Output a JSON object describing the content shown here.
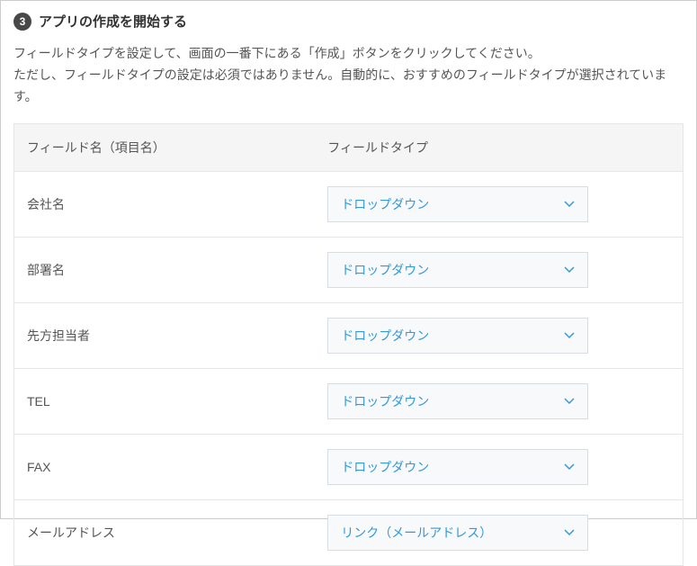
{
  "step": {
    "number": "3",
    "title": "アプリの作成を開始する"
  },
  "description": "フィールドタイプを設定して、画面の一番下にある「作成」ボタンをクリックしてください。\nただし、フィールドタイプの設定は必須ではありません。自動的に、おすすめのフィールドタイプが選択されています。",
  "table": {
    "headers": {
      "field_name": "フィールド名（項目名）",
      "field_type": "フィールドタイプ"
    },
    "rows": [
      {
        "name": "会社名",
        "type": "ドロップダウン"
      },
      {
        "name": "部署名",
        "type": "ドロップダウン"
      },
      {
        "name": "先方担当者",
        "type": "ドロップダウン"
      },
      {
        "name": "TEL",
        "type": "ドロップダウン"
      },
      {
        "name": "FAX",
        "type": "ドロップダウン"
      },
      {
        "name": "メールアドレス",
        "type": "リンク（メールアドレス）"
      }
    ]
  },
  "colors": {
    "accent": "#3498db",
    "badge": "#484848"
  }
}
